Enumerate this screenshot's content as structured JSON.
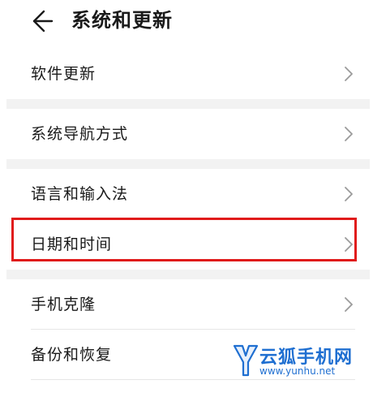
{
  "header": {
    "back_icon": "arrow-left-icon",
    "title": "系统和更新"
  },
  "groups": [
    {
      "items": [
        {
          "label": "软件更新"
        }
      ]
    },
    {
      "items": [
        {
          "label": "系统导航方式"
        }
      ]
    },
    {
      "items": [
        {
          "label": "语言和输入法"
        },
        {
          "label": "日期和时间",
          "highlighted": true
        }
      ]
    },
    {
      "items": [
        {
          "label": "手机克隆"
        },
        {
          "label": "备份和恢复"
        }
      ]
    }
  ],
  "chevron_icon": "chevron-right-icon",
  "highlight_color": "#e01b1b",
  "watermark": {
    "name": "云狐手机网",
    "url": "www.yunhu.net"
  }
}
